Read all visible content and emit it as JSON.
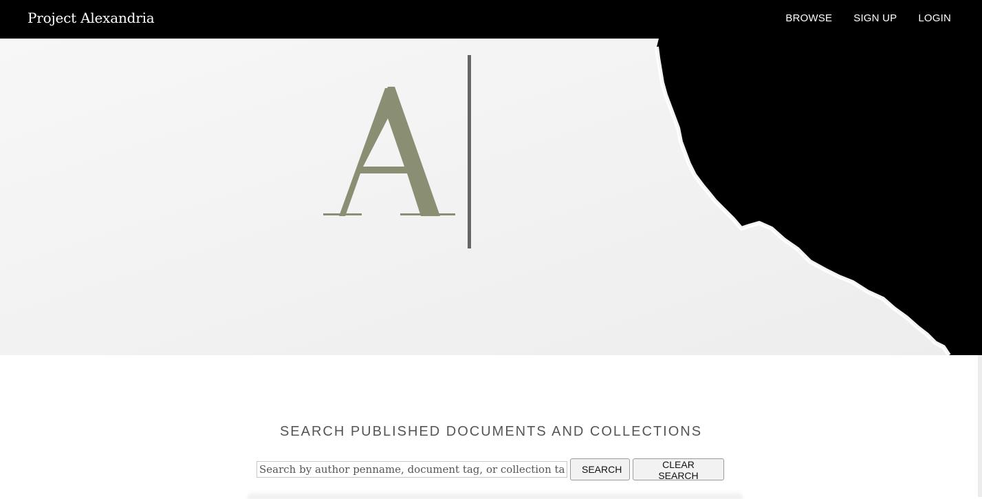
{
  "app": {
    "brand": "Project Alexandria",
    "colors": {
      "nav_bg": "#000000",
      "logo_green": "#8a8f74",
      "cursor_gray": "#666666",
      "heading_gray": "#555555"
    }
  },
  "nav": {
    "links": [
      "BROWSE",
      "SIGN UP",
      "LOGIN"
    ]
  },
  "hero": {
    "logo_letter": "A"
  },
  "search": {
    "heading": "SEARCH PUBLISHED DOCUMENTS AND COLLECTIONS",
    "input_placeholder": "Search by author penname, document tag, or collection tag",
    "input_value": "",
    "search_button": "SEARCH",
    "clear_button": "CLEAR SEARCH"
  }
}
